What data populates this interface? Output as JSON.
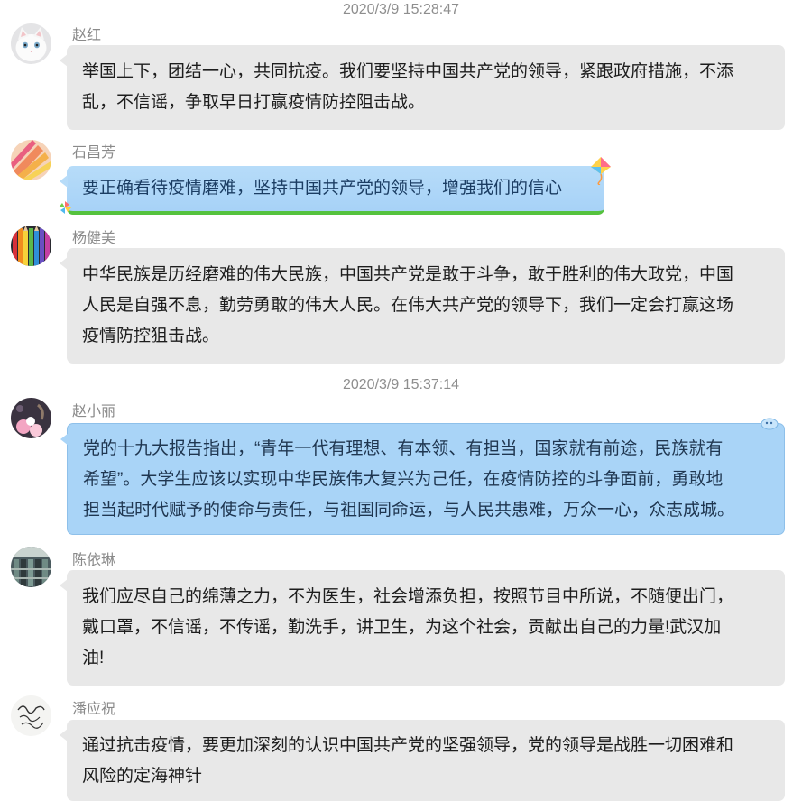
{
  "timestamps": [
    "2020/3/9 15:28:47",
    "2020/3/9 15:37:14"
  ],
  "messages": [
    {
      "sender": "赵红",
      "avatar_icon": "white-cat-avatar",
      "bubble_style": "gray",
      "lines": [
        "举国上下，团结一心，共同抗疫。我们要坚持中国共产党的领导，紧跟政府措施，不添",
        "乱，不信谣，争取早日打赢疫情防控阻击战。"
      ]
    },
    {
      "sender": "石昌芳",
      "avatar_icon": "pencils-avatar",
      "bubble_style": "blue-kite",
      "lines": [
        "要正确看待疫情磨难，坚持中国共产党的领导，增强我们的信心"
      ]
    },
    {
      "sender": "杨健美",
      "avatar_icon": "colored-pencils-avatar",
      "bubble_style": "gray",
      "lines": [
        "中华民族是历经磨难的伟大民族，中国共产党是敢于斗争，敢于胜利的伟大政党，中国",
        "人民是自强不息，勤劳勇敢的伟大人民。在伟大共产党的领导下，我们一定会打赢这场",
        "疫情防控狙击战。"
      ]
    },
    {
      "sender": "赵小丽",
      "avatar_icon": "flower-avatar",
      "bubble_style": "blue",
      "lines": [
        "党的十九大报告指出，“青年一代有理想、有本领、有担当，国家就有前途，民族就有",
        "希望”。大学生应该以实现中华民族伟大复兴为己任，在疫情防控的斗争面前，勇敢地",
        "担当起时代赋予的使命与责任，与祖国同命运，与人民共患难，万众一心，众志成城。"
      ]
    },
    {
      "sender": "陈依琳",
      "avatar_icon": "library-avatar",
      "bubble_style": "gray",
      "lines": [
        "我们应尽自己的绵薄之力，不为医生，社会增添负担，按照节目中所说，不随便出门，",
        "戴口罩，不信谣，不传谣，勤洗手，讲卫生，为这个社会，贡献出自己的力量!武汉加",
        "油!"
      ]
    },
    {
      "sender": "潘应祝",
      "avatar_icon": "signature-avatar",
      "bubble_style": "gray",
      "lines": [
        "通过抗击疫情，要更加深刻的认识中国共产党的坚强领导，党的领导是战胜一切困难和",
        "风险的定海神针"
      ]
    }
  ],
  "colors": {
    "bubble_gray": "#e8e8e8",
    "bubble_blue": "#a9d4f7",
    "name_text": "#8a8a8a",
    "timestamp_text": "#8e8e8e"
  }
}
